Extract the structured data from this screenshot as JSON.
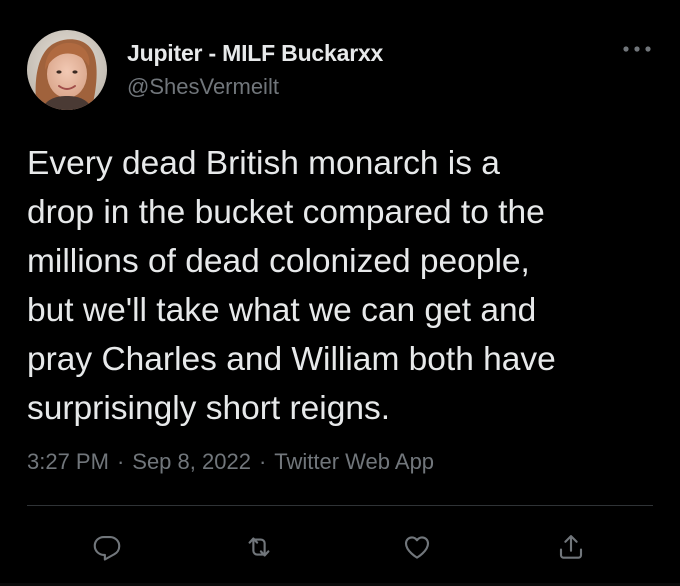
{
  "author": {
    "display_name": "Jupiter - MILF Buckarxx",
    "handle": "@ShesVermeilt"
  },
  "tweet": {
    "text_lines": [
      "Every dead British monarch is a",
      "drop in the bucket compared to the",
      "millions of dead colonized people,",
      "but we'll take what we can get and",
      "pray Charles and William both have",
      "surprisingly short reigns."
    ],
    "time": "3:27 PM",
    "date": "Sep 8, 2022",
    "separator": "·",
    "source": "Twitter Web App"
  },
  "icons": {
    "more": "more-horizontal-icon",
    "reply": "reply-icon",
    "retweet": "retweet-icon",
    "like": "heart-icon",
    "share": "share-icon"
  },
  "colors": {
    "background": "#000000",
    "primary_text": "#e7e9ea",
    "secondary_text": "#71767b",
    "divider": "#2f3336"
  }
}
